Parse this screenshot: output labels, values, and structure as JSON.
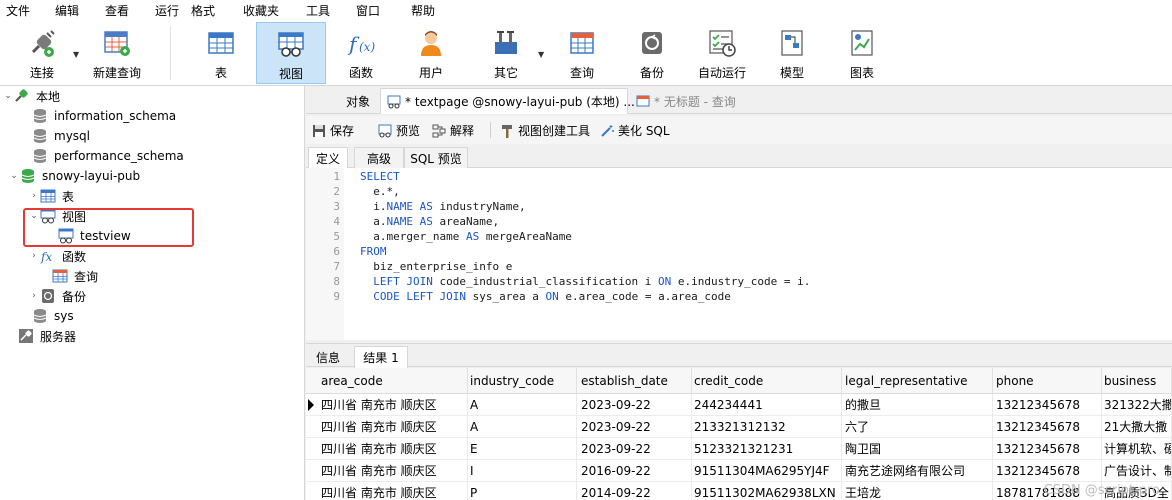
{
  "menu": [
    "文件",
    "编辑",
    "查看",
    "运行",
    "格式",
    "收藏夹",
    "工具",
    "窗口",
    "帮助"
  ],
  "toolbar": {
    "connect": "连接",
    "new_query": "新建查询",
    "table": "表",
    "view": "视图",
    "function": "函数",
    "user": "用户",
    "other": "其它",
    "query": "查询",
    "backup": "备份",
    "auto_run": "自动运行",
    "model": "模型",
    "chart": "图表"
  },
  "tree": {
    "root": "本地",
    "db1": "information_schema",
    "db2": "mysql",
    "db3": "performance_schema",
    "db4": "snowy-layui-pub",
    "tables": "表",
    "views": "视图",
    "view_item": "testview",
    "functions": "函数",
    "queries": "查询",
    "backups": "备份",
    "db5": "sys",
    "servers": "服务器"
  },
  "tabs": {
    "objects": "对象",
    "active": "* textpage @snowy-layui-pub (本地) ...",
    "untitled": "* 无标题 - 查询"
  },
  "subtools": {
    "save": "保存",
    "preview": "预览",
    "explain": "解释",
    "view_builder": "视图创建工具",
    "beautify": "美化 SQL"
  },
  "deftabs": {
    "definition": "定义",
    "advanced": "高级",
    "sql_preview": "SQL 预览"
  },
  "code": [
    {
      "n": "1",
      "text": "SELECT"
    },
    {
      "n": "2",
      "text": "  e.*,"
    },
    {
      "n": "3",
      "text": "  i.NAME AS industryName,"
    },
    {
      "n": "4",
      "text": "  a.NAME AS areaName,"
    },
    {
      "n": "5",
      "text": "  a.merger_name AS mergeAreaName"
    },
    {
      "n": "6",
      "text": "FROM"
    },
    {
      "n": "7",
      "text": "  biz_enterprise_info e"
    },
    {
      "n": "8",
      "text": "  LEFT JOIN code_industrial_classification i ON e.industry_code = i."
    },
    {
      "n": "9",
      "text": "  CODE LEFT JOIN sys_area a ON e.area_code = a.area_code"
    }
  ],
  "restabs": {
    "info": "信息",
    "result": "结果 1"
  },
  "grid": {
    "columns": [
      "area_code",
      "industry_code",
      "establish_date",
      "credit_code",
      "legal_representative",
      "phone",
      "business"
    ],
    "rows": [
      [
        "四川省 南充市 顺庆区",
        "A",
        "2023-09-22",
        "244234441",
        "的撒旦",
        "13212345678",
        "321322大撒"
      ],
      [
        "四川省 南充市 顺庆区",
        "A",
        "2023-09-22",
        "213321312132",
        "六了",
        "13212345678",
        "21大撒大撒"
      ],
      [
        "四川省 南充市 顺庆区",
        "E",
        "2023-09-22",
        "5123321321231",
        "陶卫国",
        "13212345678",
        "计算机软、硬"
      ],
      [
        "四川省 南充市 顺庆区",
        "I",
        "2016-09-22",
        "91511304MA6295YJ4F",
        "南充艺途网络有限公司",
        "13212345678",
        "广告设计、制"
      ],
      [
        "四川省 南充市 顺庆区",
        "P",
        "2014-09-22",
        "91511302MA62938LXN",
        "王培龙",
        "18781781888",
        "高品质3D全"
      ]
    ]
  },
  "watermark": "CSDN @script-pro",
  "colors": {
    "accent": "#1a55c8",
    "active_tab": "#cce4f7",
    "highlight": "#e53935"
  }
}
